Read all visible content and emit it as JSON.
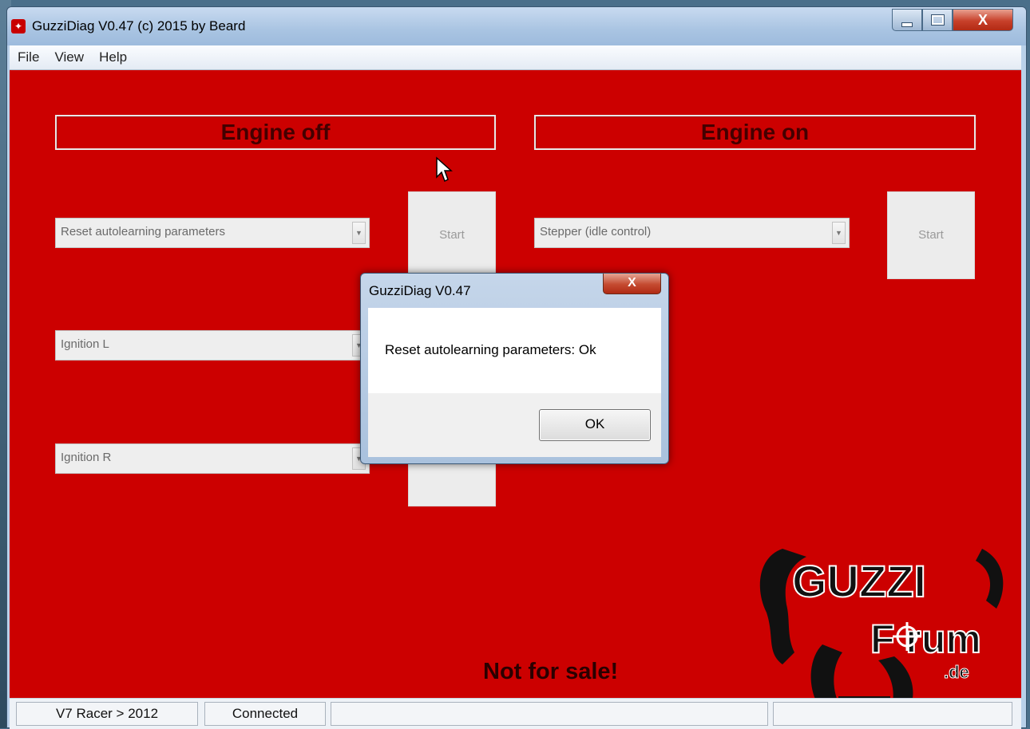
{
  "window": {
    "title": "GuzziDiag V0.47  (c) 2015 by Beard",
    "close_label": "X"
  },
  "menu": {
    "items": [
      "File",
      "View",
      "Help"
    ]
  },
  "panels": {
    "engine_off": {
      "heading": "Engine off",
      "procedures": [
        "Reset autolearning parameters",
        "Ignition L",
        "Ignition R"
      ],
      "start_label": "Start"
    },
    "engine_on": {
      "heading": "Engine on",
      "procedures": [
        "Stepper (idle control)"
      ],
      "start_label": "Start"
    }
  },
  "footer_note": "Not for sale!",
  "logo": {
    "text_top": "GUZZI",
    "text_bottom": "F rum",
    "text_domain": ".de"
  },
  "statusbar": {
    "model": "V7 Racer > 2012",
    "connection": "Connected"
  },
  "dialog": {
    "title": "GuzziDiag V0.47",
    "message": "Reset autolearning parameters: Ok",
    "ok_label": "OK",
    "close_label": "X"
  },
  "colors": {
    "client_background": "#cc0000",
    "heading_text": "#440000"
  }
}
